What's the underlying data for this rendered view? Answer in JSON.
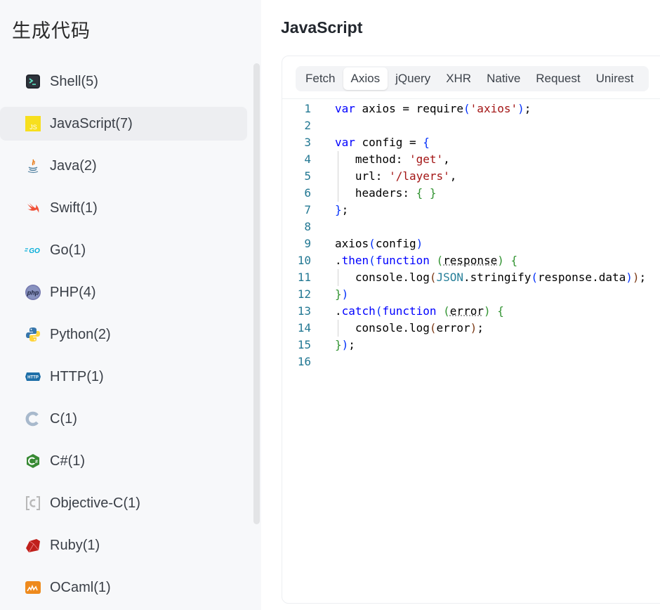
{
  "sidebar": {
    "title": "生成代码",
    "items": [
      {
        "label": "Shell(5)",
        "icon": "terminal-icon"
      },
      {
        "label": "JavaScript(7)",
        "icon": "javascript-icon",
        "active": true
      },
      {
        "label": "Java(2)",
        "icon": "java-icon"
      },
      {
        "label": "Swift(1)",
        "icon": "swift-icon"
      },
      {
        "label": "Go(1)",
        "icon": "go-icon"
      },
      {
        "label": "PHP(4)",
        "icon": "php-icon"
      },
      {
        "label": "Python(2)",
        "icon": "python-icon"
      },
      {
        "label": "HTTP(1)",
        "icon": "http-icon"
      },
      {
        "label": "C(1)",
        "icon": "c-icon"
      },
      {
        "label": "C#(1)",
        "icon": "csharp-icon"
      },
      {
        "label": "Objective-C(1)",
        "icon": "objective-c-icon"
      },
      {
        "label": "Ruby(1)",
        "icon": "ruby-icon"
      },
      {
        "label": "OCaml(1)",
        "icon": "ocaml-icon"
      }
    ]
  },
  "main": {
    "title": "JavaScript",
    "tabs": [
      "Fetch",
      "Axios",
      "jQuery",
      "XHR",
      "Native",
      "Request",
      "Unirest"
    ],
    "active_tab": "Axios",
    "code_lines": [
      "var axios = require('axios');",
      "",
      "var config = {",
      "  method: 'get',",
      "  url: '/layers',",
      "  headers: { }",
      "};",
      "",
      "axios(config)",
      ".then(function (response) {",
      "  console.log(JSON.stringify(response.data));",
      "})",
      ".catch(function (error) {",
      "  console.log(error);",
      "});",
      ""
    ],
    "line_numbers": [
      "1",
      "2",
      "3",
      "4",
      "5",
      "6",
      "7",
      "8",
      "9",
      "10",
      "11",
      "12",
      "13",
      "14",
      "15",
      "16"
    ]
  },
  "colors": {
    "keyword": "#0000ff",
    "string": "#a31515",
    "line_number": "#237893",
    "active_item_bg": "#edeef1"
  }
}
